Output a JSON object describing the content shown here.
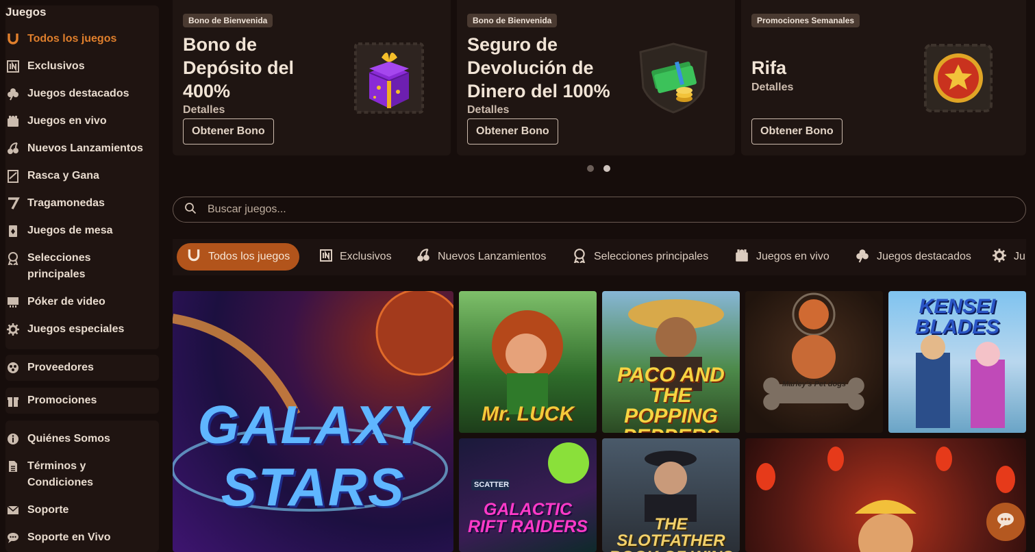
{
  "sidebar": {
    "heading": "Juegos",
    "items": [
      {
        "label": "Todos los juegos",
        "icon": "horseshoe-icon",
        "active": true
      },
      {
        "label": "Exclusivos",
        "icon": "exclusive-icon"
      },
      {
        "label": "Juegos destacados",
        "icon": "clover-icon"
      },
      {
        "label": "Juegos en vivo",
        "icon": "dealer-icon"
      },
      {
        "label": "Nuevos Lanzamientos",
        "icon": "cherries-icon"
      },
      {
        "label": "Rasca y Gana",
        "icon": "scratch-card-icon"
      },
      {
        "label": "Tragamonedas",
        "icon": "seven-icon"
      },
      {
        "label": "Juegos de mesa",
        "icon": "playing-card-icon"
      },
      {
        "label": "Selecciones principales",
        "icon": "award-icon"
      },
      {
        "label": "Póker de video",
        "icon": "video-poker-icon"
      },
      {
        "label": "Juegos especiales",
        "icon": "gear-icon"
      }
    ],
    "providers": {
      "label": "Proveedores",
      "icon": "providers-icon"
    },
    "promotions": {
      "label": "Promociones",
      "icon": "gift-icon"
    },
    "info": [
      {
        "label": "Quiénes Somos",
        "icon": "info-icon"
      },
      {
        "label": "Términos y Condiciones",
        "icon": "document-icon"
      },
      {
        "label": "Soporte",
        "icon": "mail-icon"
      },
      {
        "label": "Soporte en Vivo",
        "icon": "chat-icon"
      }
    ]
  },
  "promos": [
    {
      "tag": "Bono de Bienvenida",
      "title": "Bono de Depósito del 400%",
      "link": "Detalles",
      "button": "Obtener Bono",
      "image": "gift-box-icon"
    },
    {
      "tag": "Bono de Bienvenida",
      "title": "Seguro de Devolución de Dinero del 100%",
      "link": "Detalles",
      "button": "Obtener Bono",
      "image": "money-shield-icon"
    },
    {
      "tag": "Promociones Semanales",
      "title": "Rifa",
      "link": "Detalles",
      "button": "Obtener Bono",
      "image": "star-coin-icon"
    }
  ],
  "carousel": {
    "pages": 2,
    "active_page": 2
  },
  "search": {
    "placeholder": "Buscar juegos..."
  },
  "categories": [
    {
      "label": "Todos los juegos",
      "icon": "horseshoe-icon",
      "active": true
    },
    {
      "label": "Exclusivos",
      "icon": "exclusive-icon"
    },
    {
      "label": "Nuevos Lanzamientos",
      "icon": "cherries-icon"
    },
    {
      "label": "Selecciones principales",
      "icon": "award-icon"
    },
    {
      "label": "Juegos en vivo",
      "icon": "dealer-icon"
    },
    {
      "label": "Juegos destacados",
      "icon": "clover-icon"
    },
    {
      "label": "Ju",
      "icon": "gear-icon"
    }
  ],
  "games": [
    {
      "title": "GALAXY STARS"
    },
    {
      "title": "Mr. LUCK"
    },
    {
      "title": "PACO AND THE POPPING PEPPERS"
    },
    {
      "title": "Marley's Pet dogs"
    },
    {
      "title": "KENSEI BLADES"
    },
    {
      "title": "GALACTIC RIFT RAIDERS",
      "badge": "SCATTER"
    },
    {
      "title": "THE SLOTFATHER BOOK OF WINS"
    },
    {
      "title": ""
    }
  ],
  "colors": {
    "accent": "#e07f2c",
    "active_pill": "#b2541b",
    "background": "#160d0b"
  }
}
